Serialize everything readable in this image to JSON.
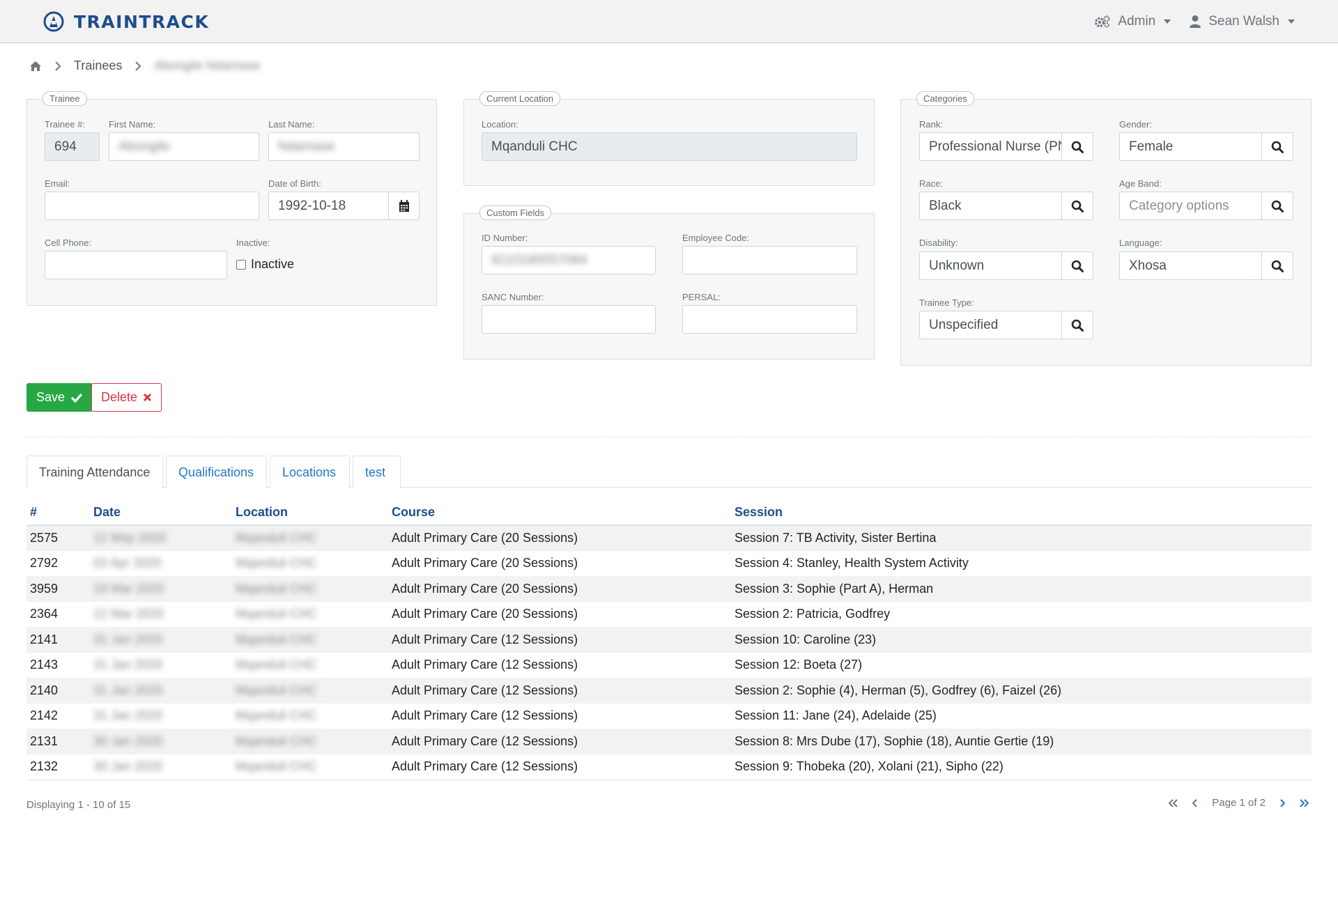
{
  "navbar": {
    "brand": "TRAINTRACK",
    "admin_label": "Admin",
    "user_label": "Sean Walsh"
  },
  "breadcrumb": {
    "section": "Trainees",
    "current": "Abongile Ndamase"
  },
  "trainee": {
    "legend": "Trainee",
    "trainee_no_label": "Trainee #:",
    "trainee_no": "694",
    "first_name_label": "First Name:",
    "first_name": "Abongile",
    "last_name_label": "Last Name:",
    "last_name": "Ndamase",
    "email_label": "Email:",
    "email": "",
    "dob_label": "Date of Birth:",
    "dob": "1992-10-18",
    "cell_label": "Cell Phone:",
    "cell": "",
    "inactive_label": "Inactive:",
    "inactive_checkbox_label": "Inactive"
  },
  "current_location": {
    "legend": "Current Location",
    "location_label": "Location:",
    "location": "Mqanduli CHC"
  },
  "custom_fields": {
    "legend": "Custom Fields",
    "id_label": "ID Number:",
    "id_value": "9210180557084",
    "employee_code_label": "Employee Code:",
    "employee_code": "",
    "sanc_label": "SANC Number:",
    "sanc": "",
    "persal_label": "PERSAL:",
    "persal": ""
  },
  "categories": {
    "legend": "Categories",
    "rank_label": "Rank:",
    "rank": "Professional Nurse (PN)",
    "gender_label": "Gender:",
    "gender": "Female",
    "race_label": "Race:",
    "race": "Black",
    "age_band_label": "Age Band:",
    "age_band_placeholder": "Category options",
    "disability_label": "Disability:",
    "disability": "Unknown",
    "language_label": "Language:",
    "language": "Xhosa",
    "trainee_type_label": "Trainee Type:",
    "trainee_type": "Unspecified"
  },
  "actions": {
    "save_label": "Save",
    "delete_label": "Delete"
  },
  "tabs": [
    "Training Attendance",
    "Qualifications",
    "Locations",
    "test"
  ],
  "table": {
    "headers": [
      "#",
      "Date",
      "Location",
      "Course",
      "Session"
    ],
    "rows": [
      [
        "2575",
        "12 May 2020",
        "Mqanduli CHC",
        "Adult Primary Care (20 Sessions)",
        "Session 7: TB Activity, Sister Bertina"
      ],
      [
        "2792",
        "02 Apr 2020",
        "Mqanduli CHC",
        "Adult Primary Care (20 Sessions)",
        "Session 4: Stanley, Health System Activity"
      ],
      [
        "3959",
        "19 Mar 2020",
        "Mqanduli CHC",
        "Adult Primary Care (20 Sessions)",
        "Session 3: Sophie (Part A), Herman"
      ],
      [
        "2364",
        "12 Mar 2020",
        "Mqanduli CHC",
        "Adult Primary Care (20 Sessions)",
        "Session 2: Patricia, Godfrey"
      ],
      [
        "2141",
        "31 Jan 2020",
        "Mqanduli CHC",
        "Adult Primary Care (12 Sessions)",
        "Session 10: Caroline (23)"
      ],
      [
        "2143",
        "31 Jan 2020",
        "Mqanduli CHC",
        "Adult Primary Care (12 Sessions)",
        "Session 12: Boeta (27)"
      ],
      [
        "2140",
        "31 Jan 2020",
        "Mqanduli CHC",
        "Adult Primary Care (12 Sessions)",
        "Session 2: Sophie (4), Herman (5), Godfrey (6), Faizel (26)"
      ],
      [
        "2142",
        "31 Jan 2020",
        "Mqanduli CHC",
        "Adult Primary Care (12 Sessions)",
        "Session 11: Jane (24), Adelaide (25)"
      ],
      [
        "2131",
        "30 Jan 2020",
        "Mqanduli CHC",
        "Adult Primary Care (12 Sessions)",
        "Session 8: Mrs Dube (17), Sophie (18), Auntie Gertie (19)"
      ],
      [
        "2132",
        "30 Jan 2020",
        "Mqanduli CHC",
        "Adult Primary Care (12 Sessions)",
        "Session 9: Thobeka (20), Xolani (21), Sipho (22)"
      ]
    ]
  },
  "footer": {
    "displaying": "Displaying 1 - 10 of 15",
    "page_text": "Page 1 of 2"
  },
  "icons": {
    "search": "search-icon",
    "calendar": "calendar-icon",
    "home": "home-icon",
    "gears": "gears-icon",
    "user": "user-icon"
  },
  "colors": {
    "brand": "#1f4d8c",
    "link": "#1f78c8",
    "success": "#28a745",
    "danger": "#dc3545"
  }
}
